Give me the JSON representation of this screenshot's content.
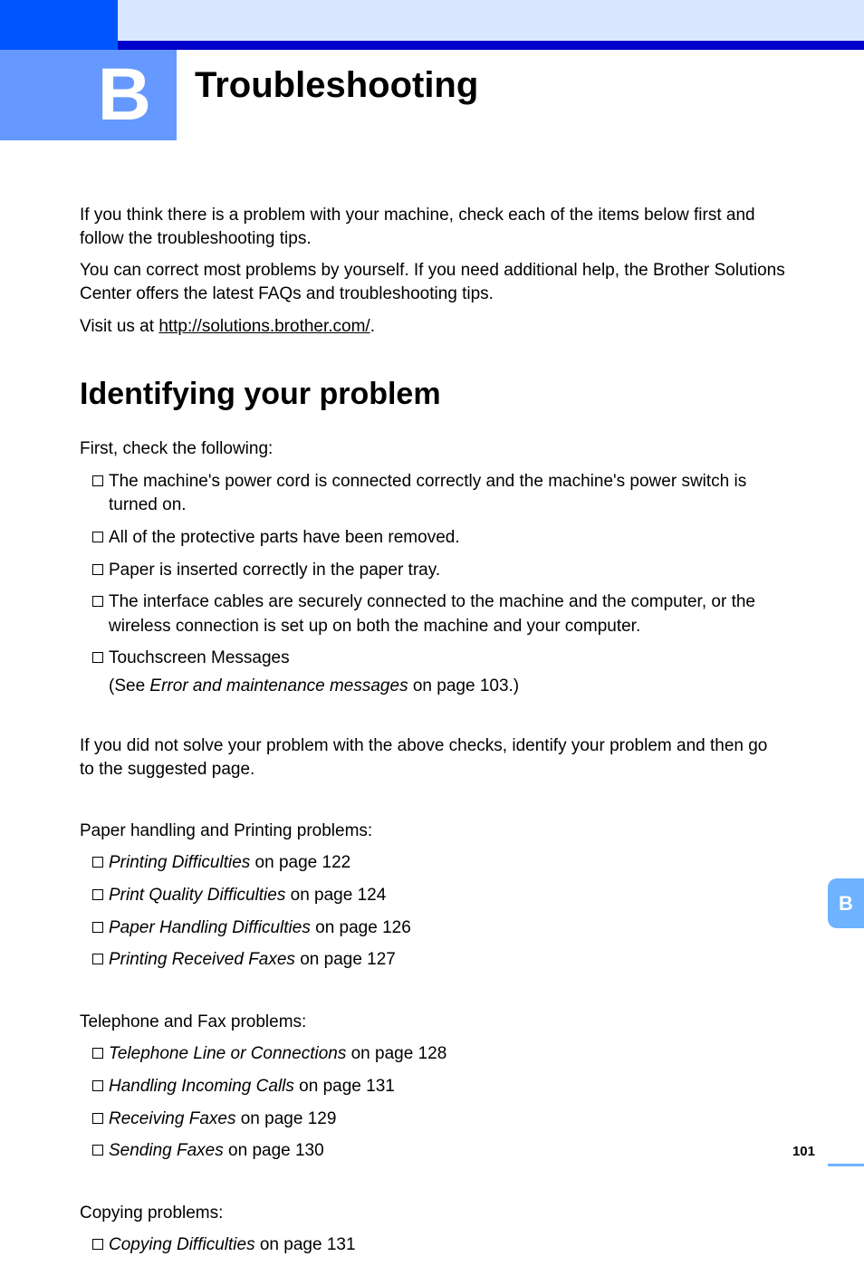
{
  "appendix_letter": "B",
  "page_title": "Troubleshooting",
  "intro": {
    "p1": "If you think there is a problem with your machine, check each of the items below first and follow the troubleshooting tips.",
    "p2": "You can correct most problems by yourself. If you need additional help, the Brother Solutions Center offers the latest FAQs and troubleshooting tips.",
    "p3_prefix": "Visit us at ",
    "p3_url": "http://solutions.brother.com/",
    "p3_suffix": "."
  },
  "section_heading": "Identifying your problem",
  "first_check": "First, check the following:",
  "check_list": [
    "The machine's power cord is connected correctly and the machine's power switch is turned on.",
    "All of the protective parts have been removed.",
    "Paper is inserted correctly in the paper tray.",
    "The interface cables are securely connected to the machine and the computer, or the wireless connection is set up on both the machine and your computer.",
    "Touchscreen Messages"
  ],
  "touchscreen_note_prefix": "(See ",
  "touchscreen_note_italic": "Error and maintenance messages",
  "touchscreen_note_suffix": " on page 103.)",
  "followup": "If you did not solve your problem with the above checks, identify your problem and then go to the suggested page.",
  "groups": [
    {
      "heading": "Paper handling and Printing problems:",
      "items": [
        {
          "title": "Printing Difficulties",
          "suffix": " on page 122"
        },
        {
          "title": "Print Quality Difficulties",
          "suffix": " on page 124"
        },
        {
          "title": "Paper Handling Difficulties",
          "suffix": " on page 126"
        },
        {
          "title": "Printing Received Faxes",
          "suffix": " on page 127"
        }
      ]
    },
    {
      "heading": "Telephone and Fax problems:",
      "items": [
        {
          "title": "Telephone Line or Connections",
          "suffix": " on page 128"
        },
        {
          "title": "Handling Incoming Calls",
          "suffix": " on page 131"
        },
        {
          "title": "Receiving Faxes",
          "suffix": " on page 129"
        },
        {
          "title": "Sending Faxes",
          "suffix": " on page 130"
        }
      ]
    },
    {
      "heading": "Copying problems:",
      "items": [
        {
          "title": "Copying Difficulties",
          "suffix": " on page 131"
        }
      ]
    }
  ],
  "side_tab": "B",
  "page_number": "101"
}
